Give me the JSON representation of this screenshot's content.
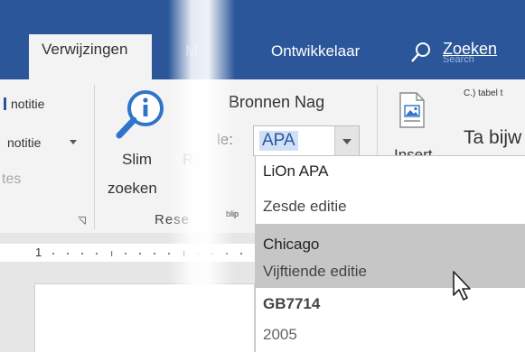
{
  "tabs": {
    "active": "Verwijzingen",
    "hidden": "M",
    "developer": "Ontwikkelaar"
  },
  "search": {
    "label": "Zoeken",
    "ghost": "Search"
  },
  "ribbon": {
    "footnote_1": "notitie",
    "footnote_2": "notitie",
    "footnote_3": "tes",
    "smart_lookup_1": "Slim",
    "smart_lookup_2": "zoeken",
    "research_fragment": "R",
    "group_research": "Rese",
    "sources_label": "Bronnen Nag",
    "style_label": "le:",
    "style_value": "APA",
    "bibliography_fragment": "blip",
    "insert_label": "Insert",
    "caption_small": "C.) tabel t",
    "table_label": "Ta bijw"
  },
  "dropdown": {
    "items": [
      {
        "title": "LiOn APA",
        "subtitle": "Zesde editie"
      },
      {
        "title": "Chicago",
        "subtitle": "Vijftiende editie"
      },
      {
        "title": "GB7714",
        "subtitle": "2005"
      }
    ]
  },
  "ruler": {
    "number": "1"
  },
  "colors": {
    "ribbon_blue": "#2b579a",
    "selection_gray": "#c6c6c6",
    "highlight_blue": "#cfe0f7"
  }
}
